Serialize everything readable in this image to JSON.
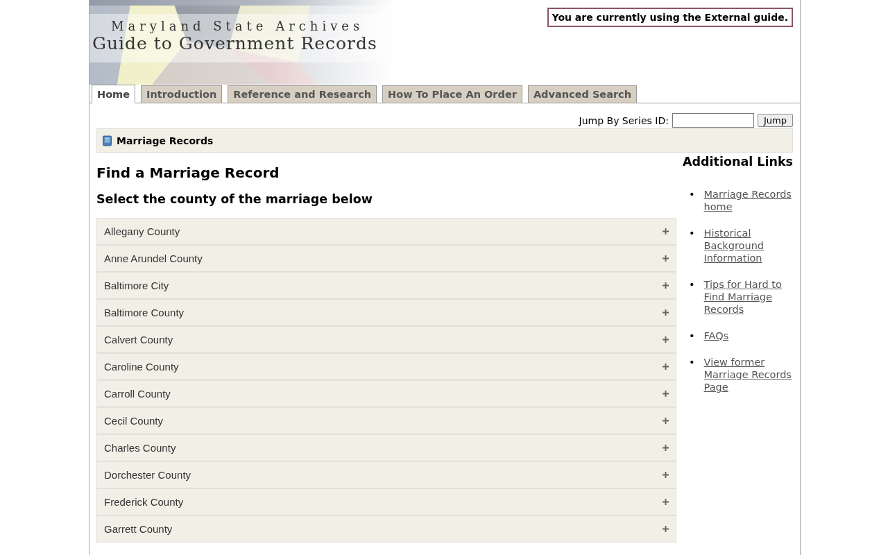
{
  "header": {
    "subtitle": "Maryland State Archives",
    "title": "Guide to Government Records",
    "guide_notice": "You are currently using the External guide."
  },
  "tabs": [
    {
      "label": "Home",
      "selected": true
    },
    {
      "label": "Introduction",
      "selected": false
    },
    {
      "label": "Reference and Research",
      "selected": false
    },
    {
      "label": "How To Place An Order",
      "selected": false
    },
    {
      "label": "Advanced Search",
      "selected": false
    }
  ],
  "jump": {
    "label": "Jump By Series ID:",
    "button": "Jump"
  },
  "breadcrumb": "Marriage Records",
  "main": {
    "heading": "Find a Marriage Record",
    "subheading": "Select the county of the marriage below",
    "counties": [
      {
        "name": "Allegany County",
        "expanded": false
      },
      {
        "name": "Anne Arundel County",
        "expanded": false
      },
      {
        "name": "Baltimore City",
        "expanded": false
      },
      {
        "name": "Baltimore County",
        "expanded": false
      },
      {
        "name": "Calvert County",
        "expanded": false
      },
      {
        "name": "Caroline County",
        "expanded": false
      },
      {
        "name": "Carroll County",
        "expanded": false
      },
      {
        "name": "Cecil County",
        "expanded": false
      },
      {
        "name": "Charles County",
        "expanded": false
      },
      {
        "name": "Dorchester County",
        "expanded": false
      },
      {
        "name": "Frederick County",
        "expanded": false
      },
      {
        "name": "Garrett County",
        "expanded": false
      }
    ]
  },
  "sidebar": {
    "heading": "Additional Links",
    "links": [
      {
        "marker": "•",
        "label": "Marriage Records home"
      },
      {
        "marker": "•",
        "label": "Historical Background Information"
      },
      {
        "marker": "•",
        "label": "Tips for Hard to Find Marriage Records"
      },
      {
        "marker": "•",
        "label": "FAQs"
      },
      {
        "marker": "•",
        "label": "View former Marriage Records Page"
      }
    ]
  }
}
